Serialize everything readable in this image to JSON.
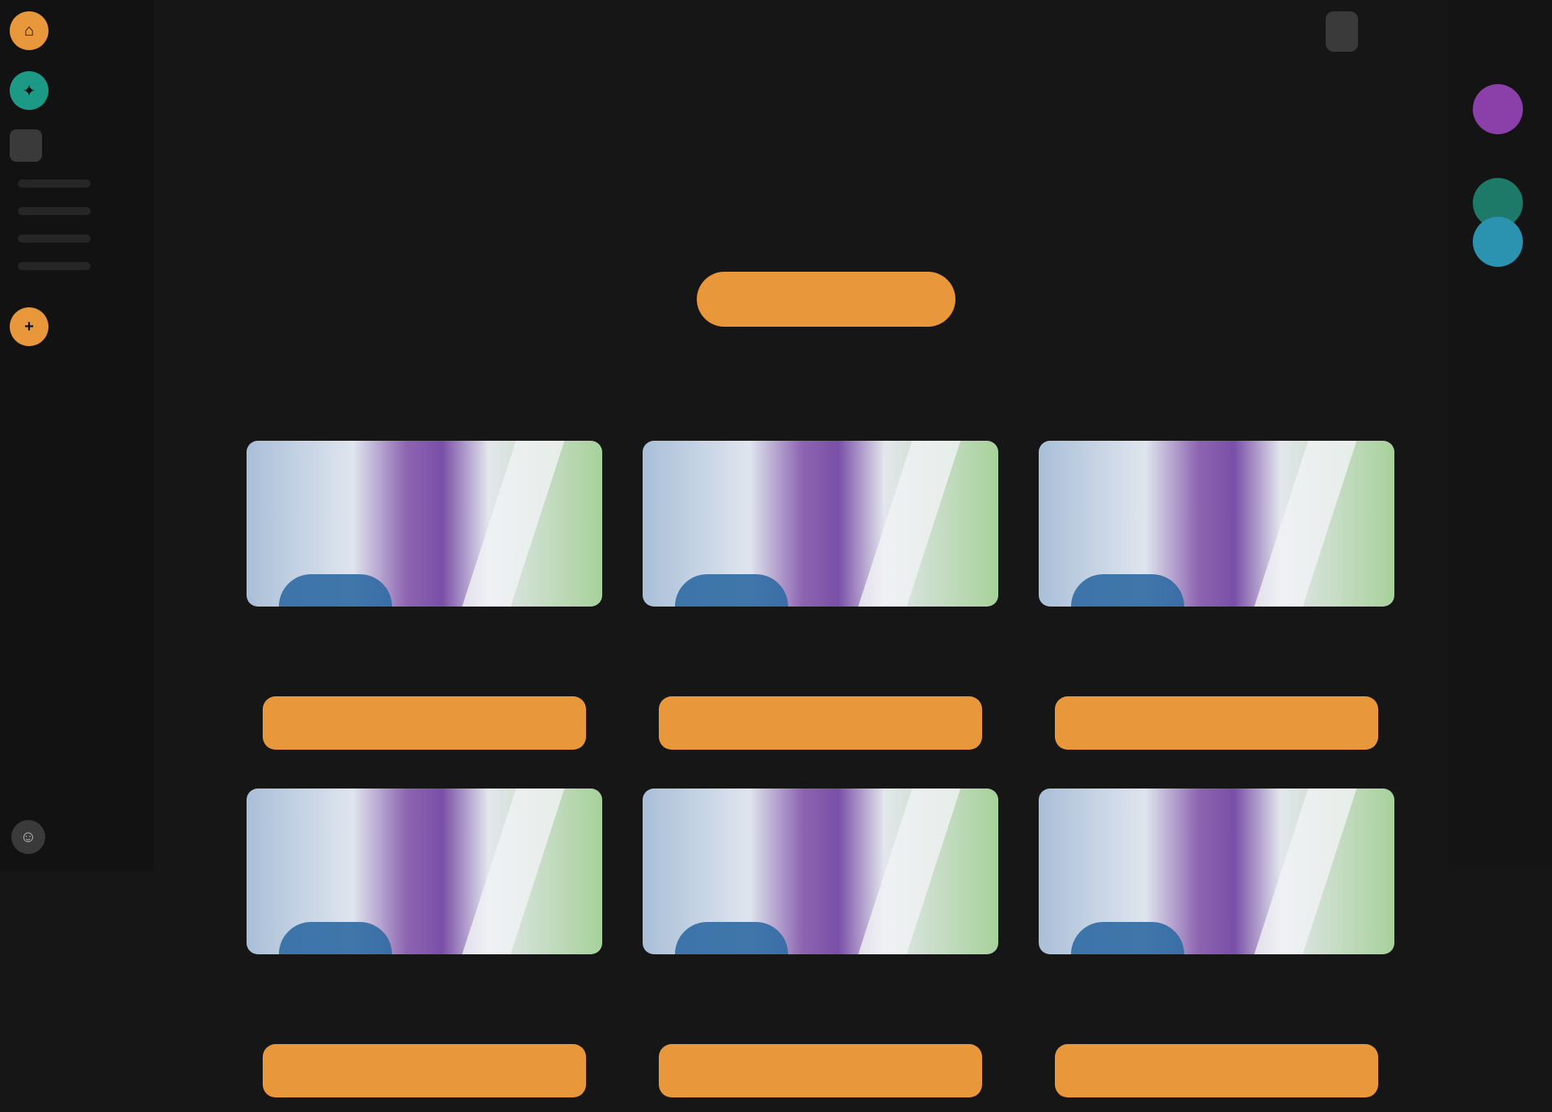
{
  "sidebar": {
    "logo_label": "",
    "items": [
      {
        "icon": "home-icon",
        "label": "",
        "color": "#e8973a"
      },
      {
        "icon": "explore-icon",
        "label": "",
        "color": "#1d9a86"
      },
      {
        "icon": "library-icon",
        "label": "",
        "color": "#3a3a3a"
      }
    ],
    "active_icon": "add-icon",
    "profile_icon": "user-icon"
  },
  "header": {
    "logo": "",
    "logo_tagline": "",
    "top_button": ""
  },
  "main": {
    "title": "",
    "hero_text": "",
    "hero_button": "",
    "section_title": ""
  },
  "cards": [
    {
      "title": "",
      "button": ""
    },
    {
      "title": "",
      "button": ""
    },
    {
      "title": "",
      "button": ""
    },
    {
      "title": "",
      "button": ""
    },
    {
      "title": "",
      "button": ""
    },
    {
      "title": "",
      "button": ""
    }
  ],
  "rail": {
    "dots": [
      {
        "icon": "purple-avatar-icon",
        "color": "#8b3fa8"
      },
      {
        "icon": "teal-avatar-icon",
        "color": "#1d7a68"
      },
      {
        "icon": "blue-avatar-icon",
        "color": "#2b93b0"
      }
    ]
  },
  "colors": {
    "accent": "#e8973a",
    "background": "#161616"
  }
}
